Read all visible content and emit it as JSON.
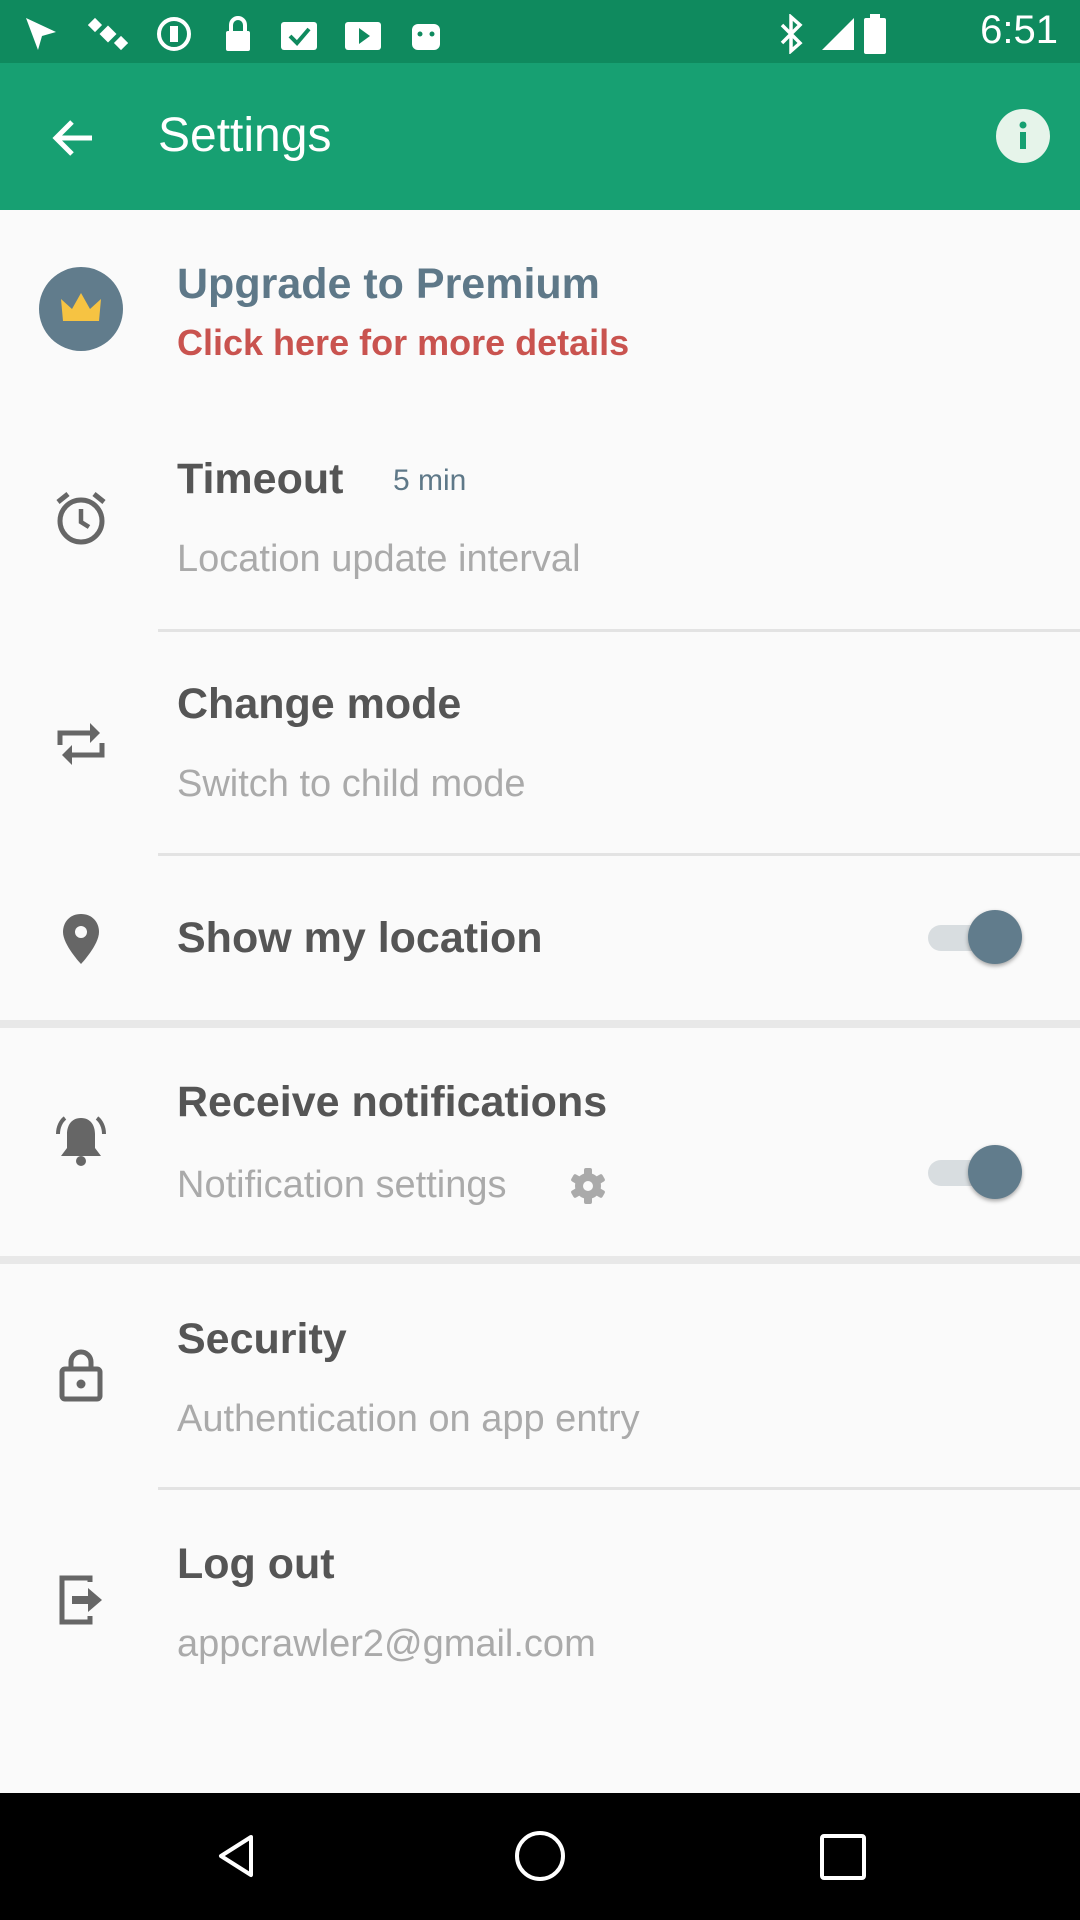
{
  "status_bar": {
    "time": "6:51",
    "left_icons": [
      "fake-gps-icon",
      "satellite-icon",
      "sync-icon",
      "lock-icon",
      "task-check-icon",
      "play-store-icon",
      "android-icon"
    ],
    "right_icons": [
      "bluetooth-icon",
      "signal-icon",
      "battery-icon"
    ]
  },
  "app_bar": {
    "title": "Settings",
    "background": "#17a072"
  },
  "premium": {
    "title": "Upgrade to Premium",
    "subtitle": "Click here for more details",
    "title_color": "#5e7888",
    "subtitle_color": "#c9534f"
  },
  "timeout": {
    "title": "Timeout",
    "value": "5 min",
    "subtitle": "Location update interval"
  },
  "change_mode": {
    "title": "Change mode",
    "subtitle": "Switch to child mode"
  },
  "show_location": {
    "title": "Show my location",
    "enabled": true
  },
  "notifications": {
    "title": "Receive notifications",
    "subtitle": "Notification settings",
    "enabled": true
  },
  "security": {
    "title": "Security",
    "subtitle": "Authentication on app entry"
  },
  "logout": {
    "title": "Log out",
    "subtitle": "appcrawler2@gmail.com"
  }
}
